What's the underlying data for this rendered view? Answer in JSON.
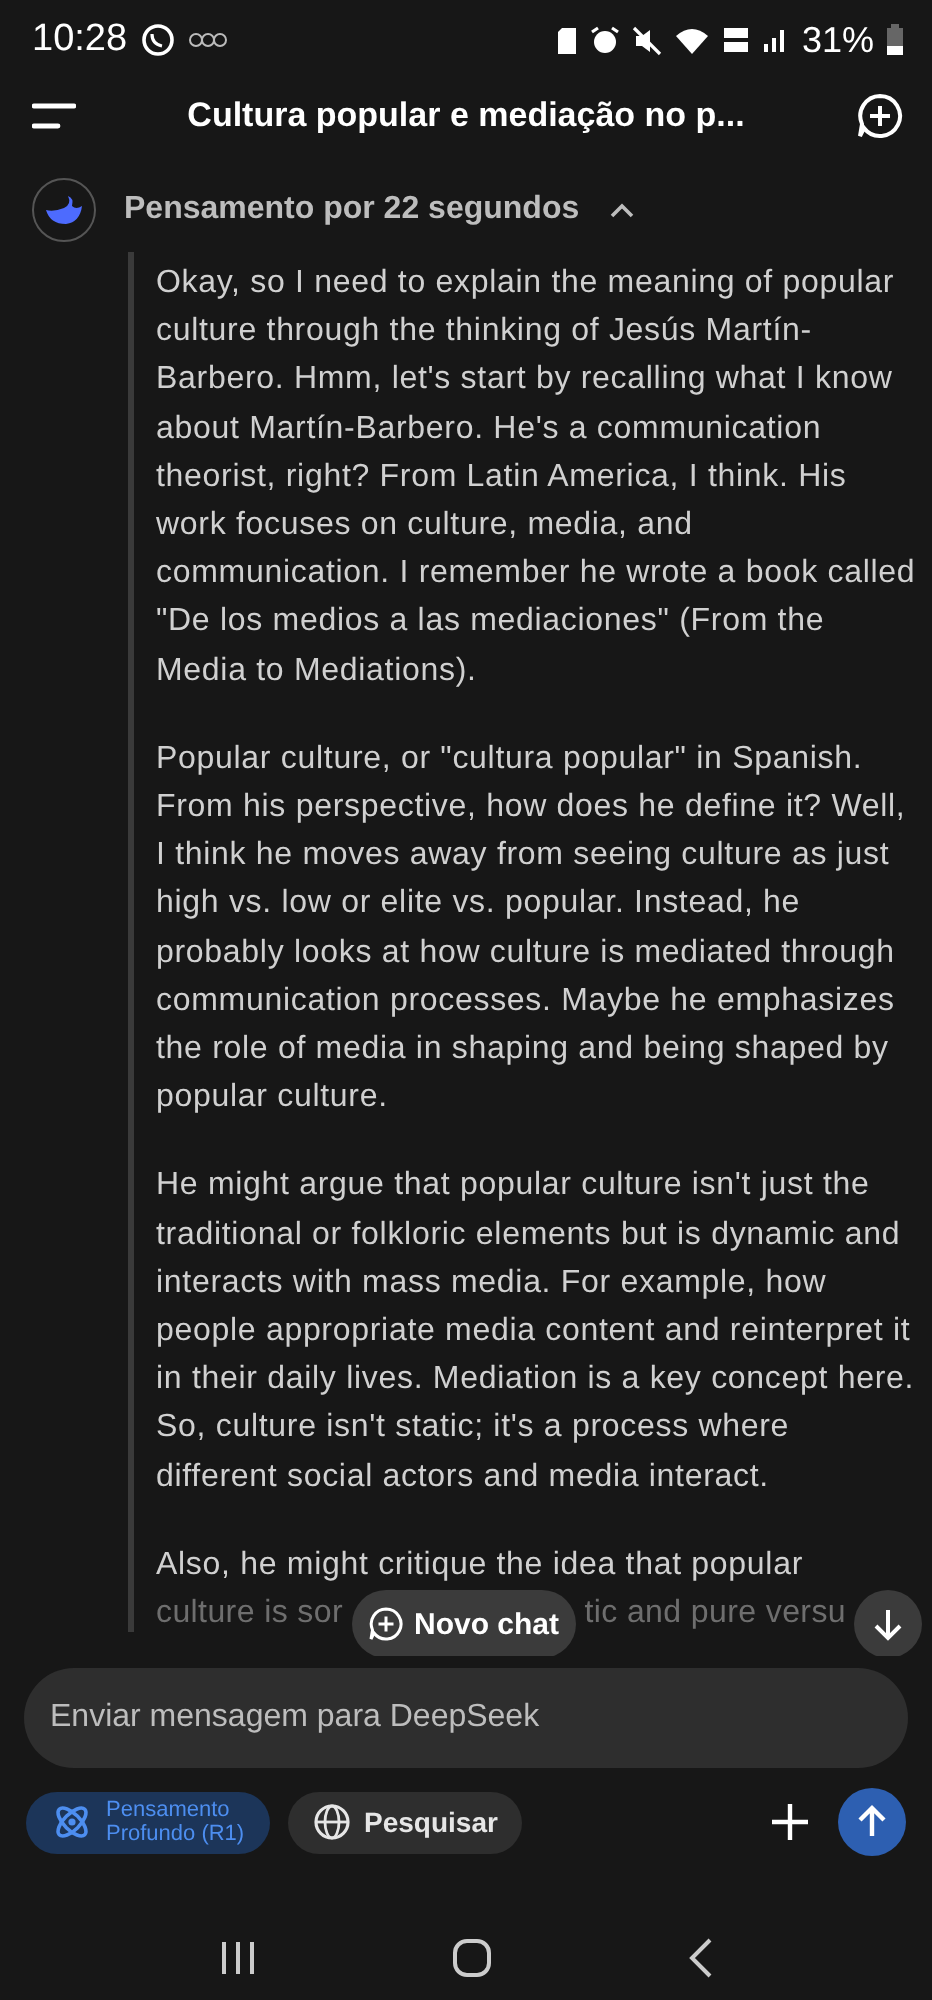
{
  "status_bar": {
    "time": "10:28",
    "battery": "31%"
  },
  "header": {
    "title": "Cultura popular e mediação no p..."
  },
  "thinking": {
    "label": "Pensamento por 22 segundos",
    "expanded": true,
    "paragraphs": [
      "Okay, so I need to explain the meaning of popular culture through the thinking of Jesús Martín-Barbero. Hmm, let's start by recalling what I know about Martín-Barbero. He's a communication theorist, right? From Latin America, I think. His work focuses on culture, media, and communication. I remember he wrote a book called \"De los medios a las mediaciones\" (From the Media to Mediations).",
      "Popular culture, or \"cultura popular\" in Spanish. From his perspective, how does he define it? Well, I think he moves away from seeing culture as just high vs. low or elite vs. popular. Instead, he probably looks at how culture is mediated through communication processes. Maybe he emphasizes the role of media in shaping and being shaped by popular culture.",
      "He might argue that popular culture isn't just the traditional or folkloric elements but is dynamic and interacts with mass media. For example, how people appropriate media content and reinterpret it in their daily lives. Mediation is a key concept here. So, culture isn't static; it's a process where different social actors and media interact."
    ],
    "last_line": "Also, he might critique the idea that popular",
    "cut_left": "culture is sor",
    "cut_right": "tic and pure versu"
  },
  "new_chat": {
    "label": "Novo chat"
  },
  "input": {
    "placeholder": "Enviar mensagem para DeepSeek"
  },
  "chips": [
    {
      "label": "Pensamento Profundo (R1)",
      "selected": true
    },
    {
      "label": "Pesquisar",
      "selected": false
    }
  ]
}
